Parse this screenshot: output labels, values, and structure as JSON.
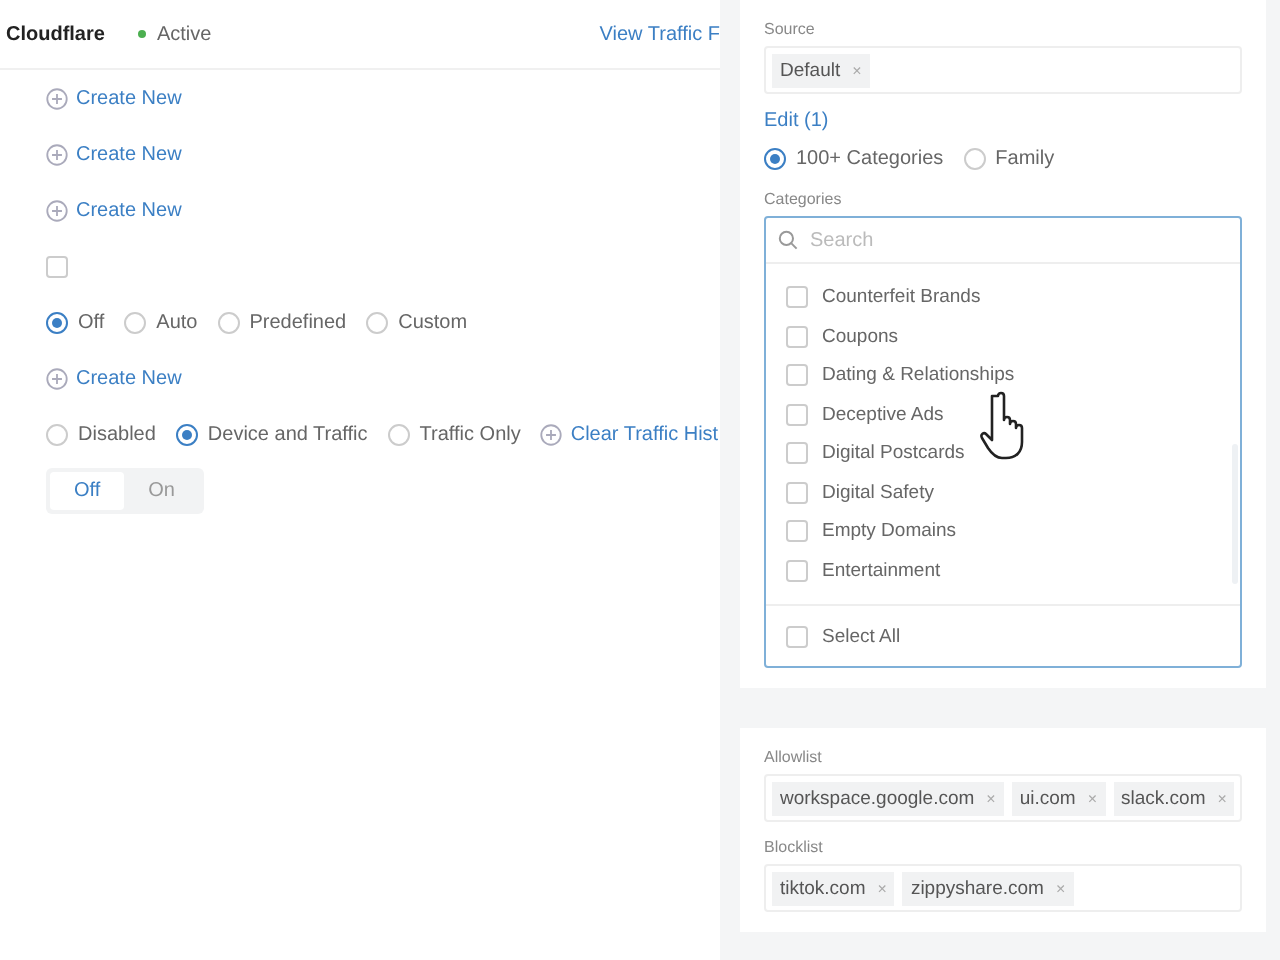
{
  "header": {
    "title": "Cloudflare",
    "status": "Active",
    "link": "View Traffic F"
  },
  "rows": [
    {
      "kind": "create",
      "label": "Create New"
    },
    {
      "kind": "create",
      "label": "Create New"
    },
    {
      "kind": "create",
      "label": "Create New"
    },
    {
      "kind": "checkbox",
      "checked": false
    },
    {
      "kind": "radios",
      "options": [
        {
          "label": "Off",
          "selected": true
        },
        {
          "label": "Auto",
          "selected": false
        },
        {
          "label": "Predefined",
          "selected": false
        },
        {
          "label": "Custom",
          "selected": false
        }
      ]
    },
    {
      "kind": "create",
      "label": "Create New"
    },
    {
      "kind": "radios",
      "options": [
        {
          "label": "Disabled",
          "selected": false
        },
        {
          "label": "Device and Traffic",
          "selected": true
        },
        {
          "label": "Traffic Only",
          "selected": false
        }
      ],
      "action": "Clear Traffic Hist"
    },
    {
      "kind": "toggle",
      "options": [
        {
          "label": "Off",
          "selected": true
        },
        {
          "label": "On",
          "selected": false
        }
      ]
    }
  ],
  "panel": {
    "source_label": "Source",
    "source_tags": [
      {
        "label": "Default",
        "remove": "×"
      }
    ],
    "edit_link": "Edit (1)",
    "mode_options": [
      {
        "label": "100+ Categories",
        "selected": true
      },
      {
        "label": "Family",
        "selected": false
      }
    ],
    "categories_label": "Categories",
    "search_placeholder": "Search",
    "categories": [
      {
        "label": "Counterfeit Brands",
        "checked": false
      },
      {
        "label": "Coupons",
        "checked": false
      },
      {
        "label": "Dating & Relationships",
        "checked": false
      },
      {
        "label": "Deceptive Ads",
        "checked": false
      },
      {
        "label": "Digital Postcards",
        "checked": false
      },
      {
        "label": "Digital Safety",
        "checked": false
      },
      {
        "label": "Empty Domains",
        "checked": false
      },
      {
        "label": "Entertainment",
        "checked": false
      }
    ],
    "select_all": {
      "label": "Select All",
      "checked": false
    },
    "allowlist_label": "Allowlist",
    "allowlist": [
      {
        "label": "workspace.google.com",
        "remove": "×"
      },
      {
        "label": "ui.com",
        "remove": "×"
      },
      {
        "label": "slack.com",
        "remove": "×"
      }
    ],
    "blocklist_label": "Blocklist",
    "blocklist": [
      {
        "label": "tiktok.com",
        "remove": "×"
      },
      {
        "label": "zippyshare.com",
        "remove": "×"
      }
    ]
  }
}
